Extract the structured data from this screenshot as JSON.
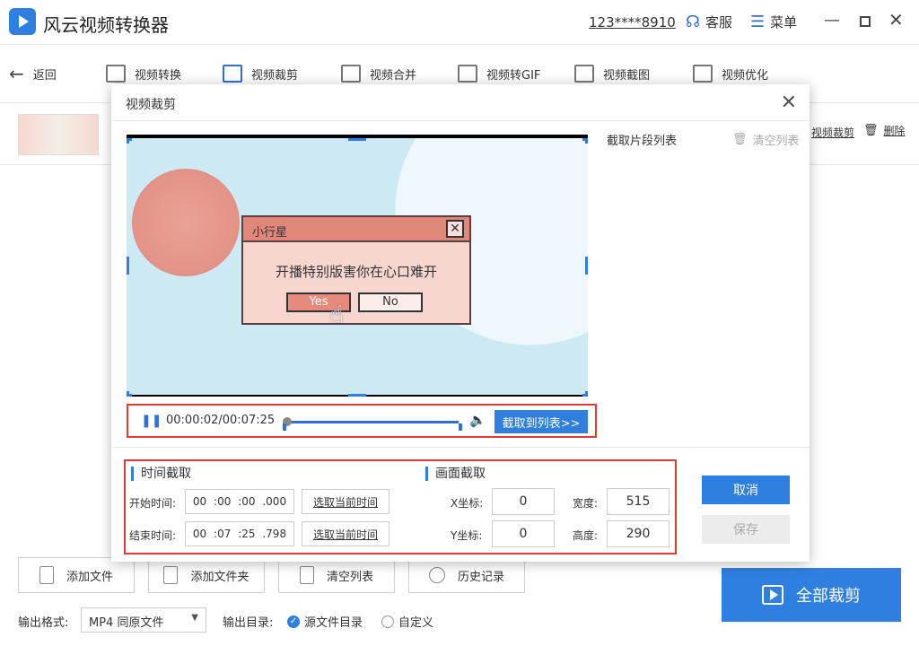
{
  "app": {
    "title": "风云视频转换器",
    "account": "123****8910",
    "service": "客服",
    "menu": "菜单"
  },
  "toolbar": {
    "back": "返回",
    "tools": [
      "视频转换",
      "视频裁剪",
      "视频合并",
      "视频转GIF",
      "视频截图",
      "视频优化"
    ]
  },
  "file_row": {
    "crop_link": "视频裁剪",
    "delete": "删除"
  },
  "dialog": {
    "title": "视频裁剪",
    "list_title": "截取片段列表",
    "clear_list": "清空列表",
    "player": {
      "time": "00:00:02/00:07:25",
      "to_list": "截取到列表>>",
      "progress_fraction": 0.004
    },
    "video": {
      "popup_title": "小行星",
      "popup_message": "开播特别版害你在心口难开",
      "popup_yes": "Yes",
      "popup_no": "No"
    },
    "time_section": {
      "title": "时间截取",
      "start_label": "开始时间:",
      "start": {
        "h": "00",
        "m": ":00",
        "s": ":00",
        "ms": ".000"
      },
      "end_label": "结束时间:",
      "end": {
        "h": "00",
        "m": ":07",
        "s": ":25",
        "ms": ".798"
      },
      "pick_current": "选取当前时间"
    },
    "frame_section": {
      "title": "画面截取",
      "x_label": "X坐标:",
      "x": "0",
      "y_label": "Y坐标:",
      "y": "0",
      "width_label": "宽度:",
      "width": "515",
      "height_label": "高度:",
      "height": "290"
    },
    "cancel": "取消",
    "save": "保存"
  },
  "bottom": {
    "add_file": "添加文件",
    "add_folder": "添加文件夹",
    "clear_list": "清空列表",
    "history": "历史记录",
    "crop_all": "全部裁剪",
    "format_label": "输出格式:",
    "format_value": "MP4 同原文件",
    "dir_label": "输出目录:",
    "dir_source": "源文件目录",
    "dir_custom": "自定义"
  },
  "colors": {
    "accent": "#2f7fe0",
    "highlight_border": "#e53935"
  }
}
